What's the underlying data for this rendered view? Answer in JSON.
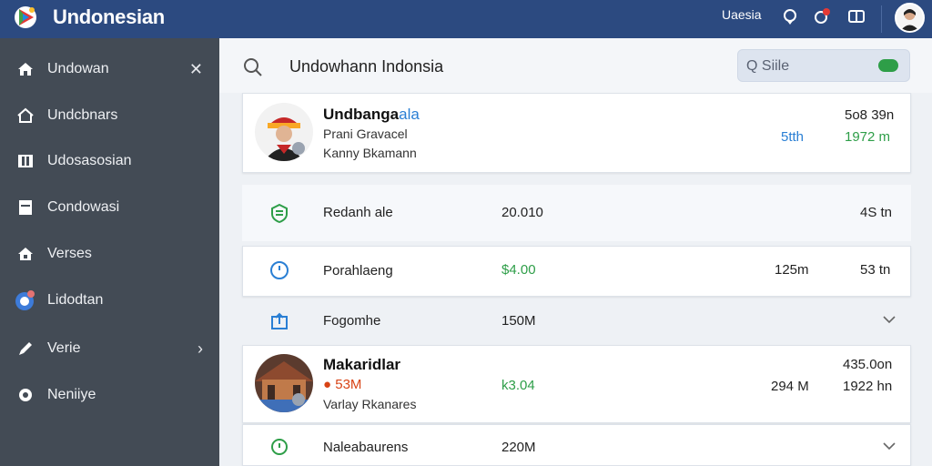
{
  "app": {
    "title": "Undonesian"
  },
  "topbar": {
    "label": "Uaesia"
  },
  "sidebar": {
    "items": [
      {
        "label": "Undowan",
        "icon": "home-icon"
      },
      {
        "label": "Undcbnars",
        "icon": "house-icon"
      },
      {
        "label": "Udosasosian",
        "icon": "library-icon"
      },
      {
        "label": "Condowasi",
        "icon": "archive-icon"
      },
      {
        "label": "Verses",
        "icon": "home-lock-icon"
      },
      {
        "label": "Lidodtan",
        "icon": "globe-icon"
      },
      {
        "label": "Verie",
        "icon": "pen-icon"
      },
      {
        "label": "Neniiye",
        "icon": "gear-icon"
      }
    ]
  },
  "search": {
    "query": "Undowhann Indonsia",
    "box_label": "Q Siile"
  },
  "rows": {
    "r1": {
      "name_a": "Undbanga",
      "name_b": "ala",
      "line1": "Prani Gravacel",
      "line2": "Kanny Bkamann",
      "mid": "5tth",
      "right_top": "5o8 39n",
      "right_bottom": "1972 m"
    },
    "r2": {
      "label": "Redanh ale",
      "mid": "20.010",
      "right": "4S tn"
    },
    "r3": {
      "label": "Porahlaeng",
      "mid": "$4.00",
      "mid2": "125m",
      "right": "53 tn"
    },
    "r4": {
      "label": "Fogomhe",
      "mid": "150M"
    },
    "r5": {
      "name": "Makaridlar",
      "line1": "53M",
      "line2": "Varlay Rkanares",
      "mid": "k3.04",
      "mid2": "294 M",
      "right_top": "435.0on",
      "right_bottom": "1922 hn"
    },
    "r6": {
      "label": "Naleabaurens",
      "mid": "220M"
    }
  },
  "colors": {
    "topbar": "#2c4a80",
    "sidebar": "#434b55",
    "accent_green": "#2e9e48",
    "accent_blue": "#2a7fd4"
  }
}
